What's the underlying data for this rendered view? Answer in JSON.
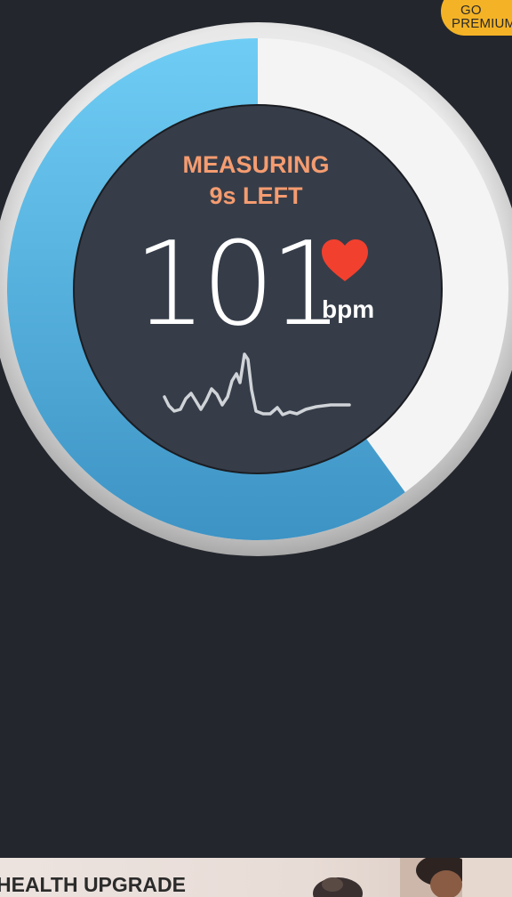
{
  "header": {
    "premium_line1": "GO",
    "premium_line2": "PREMIUM"
  },
  "measurement": {
    "status": "MEASURING",
    "time_left": "9s LEFT",
    "bpm_value": "101",
    "bpm_unit": "bpm",
    "progress_fraction": 0.6
  },
  "ad": {
    "title": "HEALTH UPGRADE"
  },
  "colors": {
    "background": "#23262d",
    "dial_inner": "#363d49",
    "progress": "#5bbce9",
    "status_text": "#f59c70",
    "heart": "#f2402e",
    "premium_button": "#f4b326"
  },
  "icons": {
    "heart": "heart-icon",
    "waveform": "heartbeat-waveform"
  }
}
